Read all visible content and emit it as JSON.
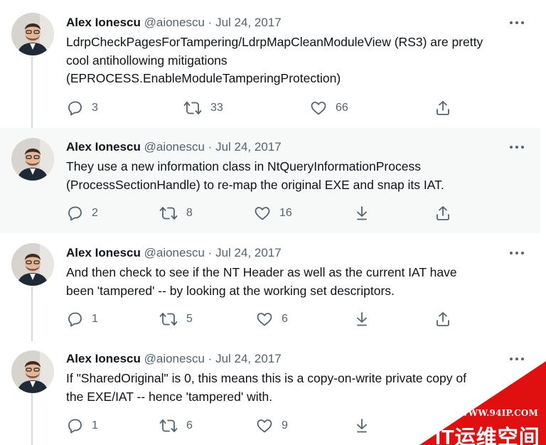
{
  "author": {
    "name": "Alex Ionescu",
    "handle": "@aionescu",
    "sep": "·",
    "date": "Jul 24, 2017"
  },
  "tweets": [
    {
      "lines": [
        "LdrpCheckPagesForTampering/LdrpMapCleanModuleView (RS3) are pretty",
        "cool antihollowing mitigations",
        "(EPROCESS.EnableModuleTamperingProtection)"
      ],
      "replies": "3",
      "retweets": "33",
      "likes": "66"
    },
    {
      "lines": [
        "They use a new information class in NtQueryInformationProcess",
        "(ProcessSectionHandle) to re-map the original EXE and snap its IAT."
      ],
      "replies": "2",
      "retweets": "8",
      "likes": "16"
    },
    {
      "lines": [
        "And then check to see if the NT Header as well as the current IAT have",
        "been 'tampered' -- by looking at the working set descriptors."
      ],
      "replies": "1",
      "retweets": "5",
      "likes": "6"
    },
    {
      "lines": [
        "If \"SharedOriginal\" is 0, this means this is a copy-on-write private copy of",
        "the EXE/IAT -- hence 'tampered' with."
      ],
      "replies": "1",
      "retweets": "6",
      "likes": "9"
    }
  ],
  "watermark": {
    "url": "WWW.94IP.COM",
    "title": "IT运维空间"
  },
  "colors": {
    "text": "#0f1419",
    "secondary": "#536471",
    "thread": "#cfd9de",
    "highlight": "#f7f9f9",
    "watermark": "#e01010"
  },
  "icons": [
    "reply-icon",
    "retweet-icon",
    "like-icon",
    "download-icon",
    "share-icon",
    "more-icon"
  ]
}
